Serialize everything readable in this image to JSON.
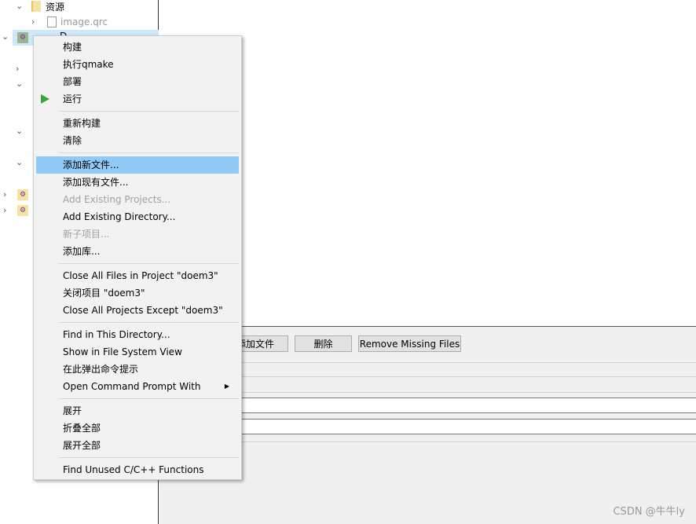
{
  "tree": {
    "items": [
      {
        "label": "资源"
      },
      {
        "label": "image.qrc"
      },
      {
        "label": "D..."
      }
    ]
  },
  "buttons": {
    "add_file": "添加文件",
    "delete": "删除",
    "remove_missing": "Remove Missing Files"
  },
  "menu": {
    "items": [
      {
        "label": "构建"
      },
      {
        "label": "执行qmake"
      },
      {
        "label": "部署"
      },
      {
        "label": "运行",
        "icon": "play-icon"
      },
      {
        "sep": true
      },
      {
        "label": "重新构建"
      },
      {
        "label": "清除"
      },
      {
        "sep": true
      },
      {
        "label": "添加新文件...",
        "highlighted": true
      },
      {
        "label": "添加现有文件..."
      },
      {
        "label": "Add Existing Projects...",
        "disabled": true
      },
      {
        "label": "Add Existing Directory..."
      },
      {
        "label": "新子项目...",
        "disabled": true
      },
      {
        "label": "添加库..."
      },
      {
        "sep": true
      },
      {
        "label": "Close All Files in Project \"doem3\""
      },
      {
        "label": "关闭项目 \"doem3\""
      },
      {
        "label": "Close All Projects Except \"doem3\""
      },
      {
        "sep": true
      },
      {
        "label": "Find in This Directory..."
      },
      {
        "label": "Show in File System View"
      },
      {
        "label": "在此弹出命令提示"
      },
      {
        "label": "Open Command Prompt With",
        "submenu": true
      },
      {
        "sep": true
      },
      {
        "label": "展开"
      },
      {
        "label": "折叠全部"
      },
      {
        "label": "展开全部"
      },
      {
        "sep": true
      },
      {
        "label": "Find Unused C/C++ Functions"
      }
    ]
  },
  "watermark": "CSDN @牛牛ly",
  "colors": {
    "highlight": "#91c9f7",
    "run": "#3aa637"
  }
}
